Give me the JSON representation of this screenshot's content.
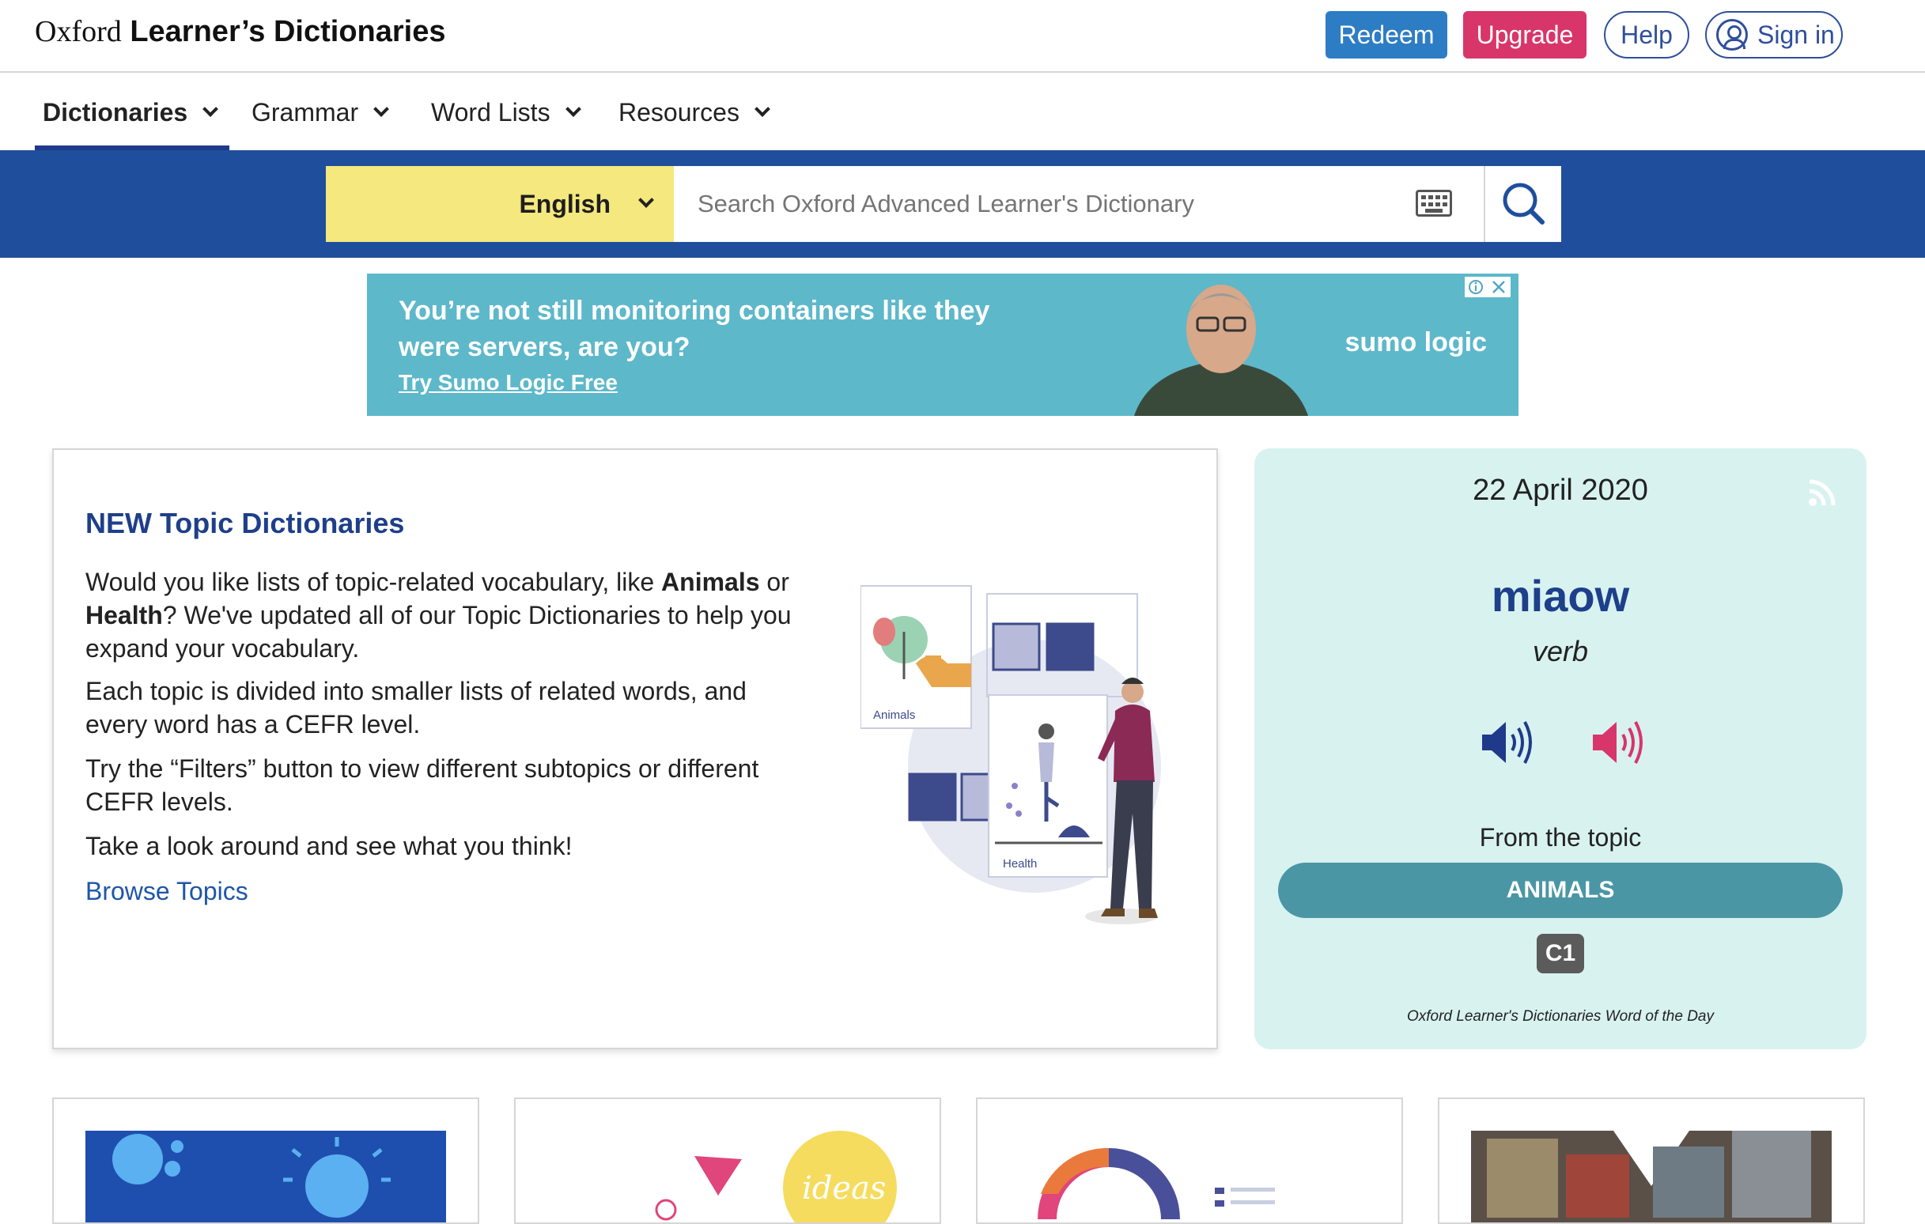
{
  "header": {
    "logo_part1": "Oxford",
    "logo_part2": "Learner’s Dictionaries",
    "redeem": "Redeem",
    "upgrade": "Upgrade",
    "help": "Help",
    "signin": "Sign in",
    "colors": {
      "redeem": "#2d7dc4",
      "upgrade": "#d8356b",
      "brand_blue": "#1f4f9c"
    }
  },
  "nav": {
    "items": [
      {
        "label": "Dictionaries",
        "active": true
      },
      {
        "label": "Grammar"
      },
      {
        "label": "Word Lists"
      },
      {
        "label": "Resources"
      }
    ]
  },
  "search": {
    "language": "English",
    "placeholder": "Search Oxford Advanced Learner's Dictionary",
    "keyboard_icon": "keyboard-icon",
    "search_icon": "search-icon"
  },
  "ad": {
    "headline": "You’re not still monitoring containers like they were servers, are you?",
    "cta": "Try Sumo Logic Free",
    "brand": "sumo logic"
  },
  "feature": {
    "title": "NEW Topic Dictionaries",
    "p1_pre": "Would you like lists of topic-related vocabulary, like ",
    "p1_b1": "Animals",
    "p1_mid": " or ",
    "p1_b2": "Health",
    "p1_post": "? We've updated all of our Topic Dictionaries to help you expand your vocabulary.",
    "p2": "Each topic is divided into smaller lists of related words, and every word has a CEFR level.",
    "p3": "Try the “Filters” button to view different subtopics or different CEFR levels.",
    "p4": "Take a look around and see what you think!",
    "link": "Browse Topics",
    "illus_animals": "Animals",
    "illus_health": "Health"
  },
  "wotd": {
    "date": "22 April 2020",
    "word": "miaow",
    "pos": "verb",
    "from": "From the topic",
    "topic": "ANIMALS",
    "cefr": "C1",
    "footer": "Oxford Learner's Dictionaries Word of the Day"
  },
  "tiles": {
    "ideas": "ideas"
  }
}
